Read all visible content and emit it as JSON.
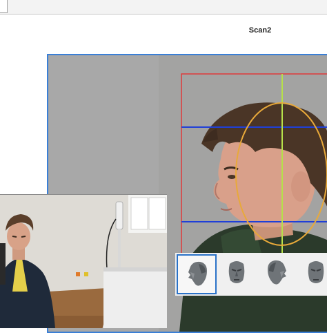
{
  "window": {
    "title": "Scan2"
  },
  "scanner": {
    "guide_colors": {
      "bounding_box": "#e03a3a",
      "horizontal_lines": "#1f3fd8",
      "center_line": "#b6e04a",
      "head_ellipse": "#e8a93a",
      "viewport_border": "#3a7fd6"
    }
  },
  "pose_thumbnails": [
    {
      "name": "head-three-quarter-left-icon",
      "selected": true
    },
    {
      "name": "head-front-icon",
      "selected": false
    },
    {
      "name": "head-three-quarter-right-icon",
      "selected": false
    },
    {
      "name": "head-front-small-icon",
      "selected": false
    }
  ]
}
